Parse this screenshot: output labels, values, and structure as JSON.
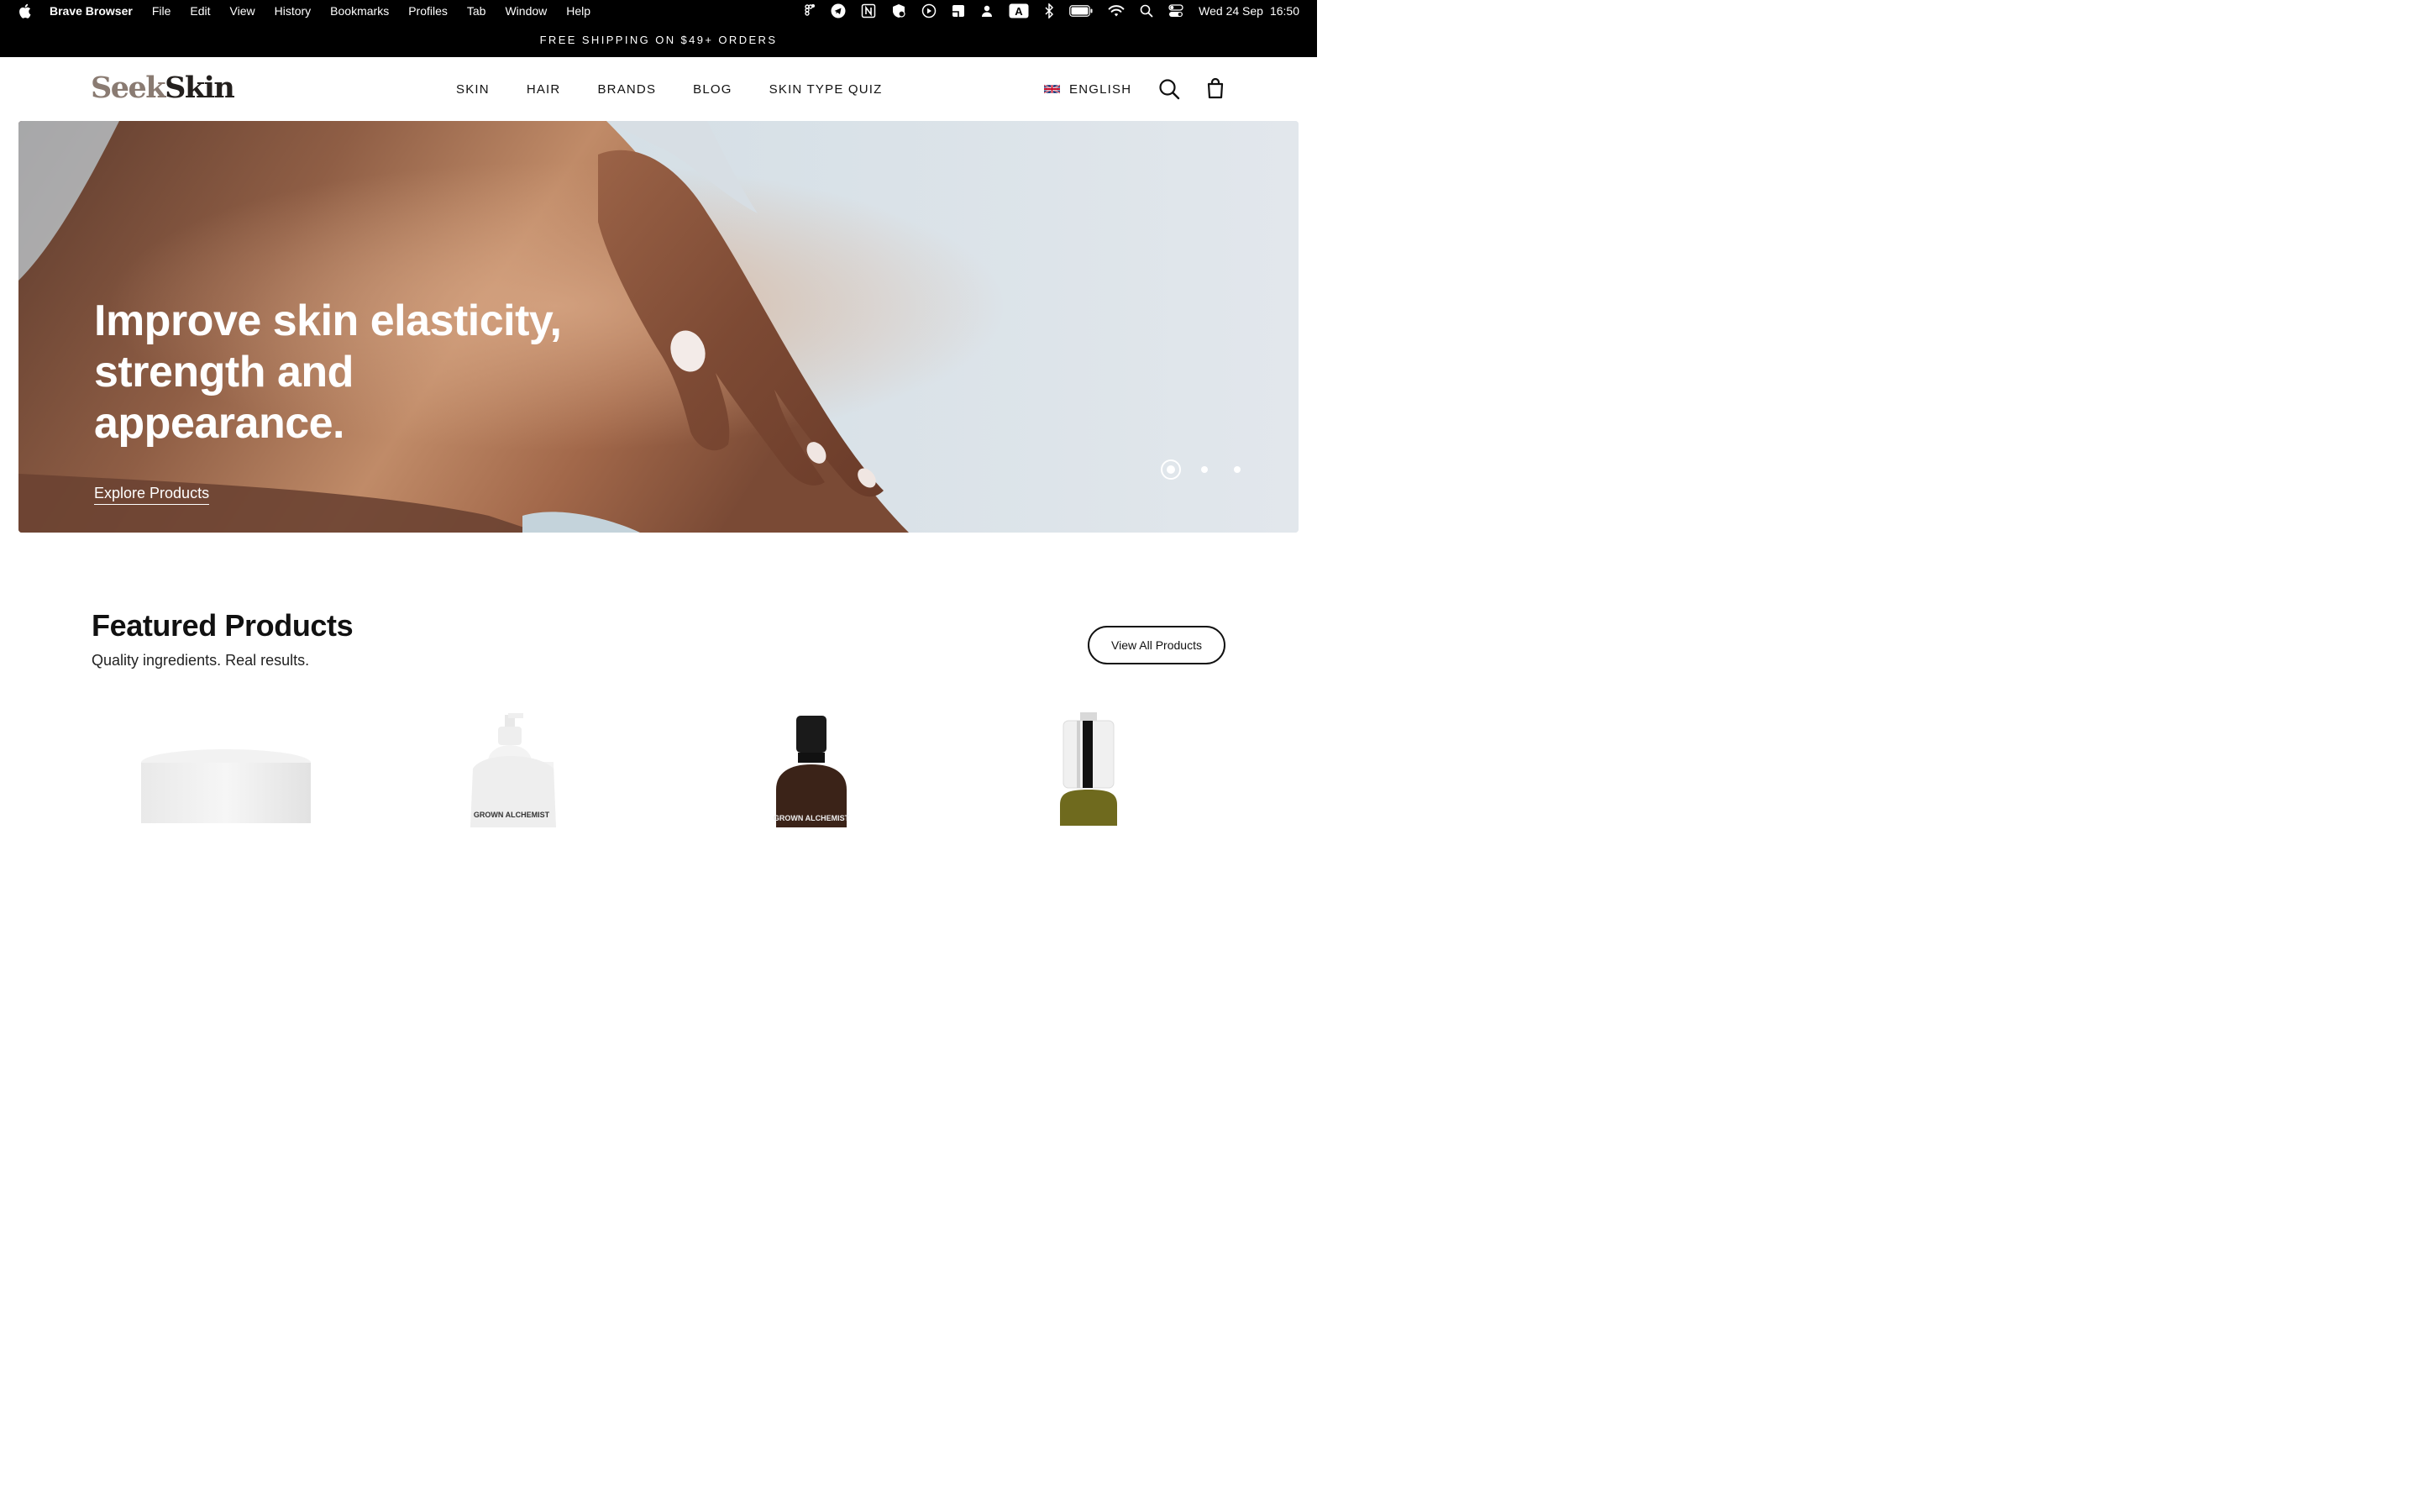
{
  "menubar": {
    "app_name": "Brave Browser",
    "items": [
      "File",
      "Edit",
      "View",
      "History",
      "Bookmarks",
      "Profiles",
      "Tab",
      "Window",
      "Help"
    ],
    "status_icons": [
      "figma-icon",
      "telegram-icon",
      "notion-icon",
      "shield-icon",
      "play-icon",
      "notes-icon",
      "user-icon",
      "keyboard-input-icon",
      "bluetooth-icon",
      "battery-icon",
      "wifi-icon",
      "spotlight-search-icon",
      "control-center-icon"
    ],
    "input_label": "A",
    "date": "Wed 24 Sep",
    "time": "16:50"
  },
  "announcement": {
    "text": "FREE SHIPPING ON $49+ ORDERS"
  },
  "header": {
    "logo_part1": "Seek",
    "logo_part2": "Skin",
    "nav": [
      "SKIN",
      "HAIR",
      "BRANDS",
      "BLOG",
      "SKIN TYPE QUIZ"
    ],
    "language": "ENGLISH",
    "search_icon": "search-icon",
    "cart_icon": "shopping-bag-icon"
  },
  "hero": {
    "title": "Improve skin elasticity, strength and appearance.",
    "link": "Explore Products",
    "slides": 3,
    "active_slide": 1
  },
  "featured": {
    "title": "Featured Products",
    "subtitle": "Quality ingredients. Real results.",
    "button": "View All Products",
    "product_labels": [
      "GROWN ALCHEMIST",
      "GROWN ALCHEMIST"
    ]
  },
  "colors": {
    "black": "#000000",
    "logo_seek": "#8a7b72",
    "logo_skin": "#231f1d",
    "hero_sky": "#dfe5ea",
    "skin_tone": "#a86f4f"
  }
}
